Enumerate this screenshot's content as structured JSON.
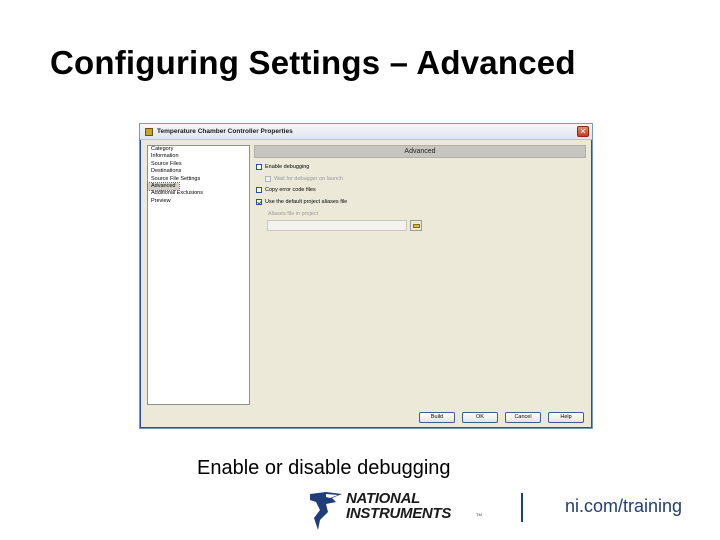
{
  "slide": {
    "title": "Configuring Settings – Advanced",
    "caption": "Enable or disable debugging",
    "footer_link": "ni.com/training"
  },
  "logo": {
    "line1": "NATIONAL",
    "line2": "INSTRUMENTS",
    "trademark": "TM",
    "brand_color": "#1f3d7a"
  },
  "dialog": {
    "title": "Temperature Chamber Controller Properties",
    "close_glyph": "✕",
    "category": {
      "header": "Category",
      "items": [
        {
          "label": "Information",
          "selected": false
        },
        {
          "label": "Source Files",
          "selected": false
        },
        {
          "label": "Destinations",
          "selected": false
        },
        {
          "label": "Source File Settings",
          "selected": false
        },
        {
          "label": "Advanced",
          "selected": true
        },
        {
          "label": "Additional Exclusions",
          "selected": false
        },
        {
          "label": "Preview",
          "selected": false
        }
      ]
    },
    "section_title": "Advanced",
    "options": {
      "enable_debugging": {
        "label": "Enable debugging",
        "checked": false,
        "enabled": true
      },
      "wait_for_debugger": {
        "label": "Wait for debugger on launch",
        "checked": false,
        "enabled": false
      },
      "copy_error_code": {
        "label": "Copy error code files",
        "checked": false,
        "enabled": true
      },
      "use_default_aliases": {
        "label": "Use the default project aliases file",
        "checked": true,
        "enabled": true
      }
    },
    "aliases": {
      "label": "Aliases file in project",
      "value": ""
    },
    "buttons": {
      "build": "Build",
      "ok": "OK",
      "cancel": "Cancel",
      "help": "Help"
    }
  },
  "icons": {
    "app": "labview-project-icon",
    "close": "close-icon",
    "browse": "folder-icon",
    "logo": "ni-eagle-icon"
  }
}
